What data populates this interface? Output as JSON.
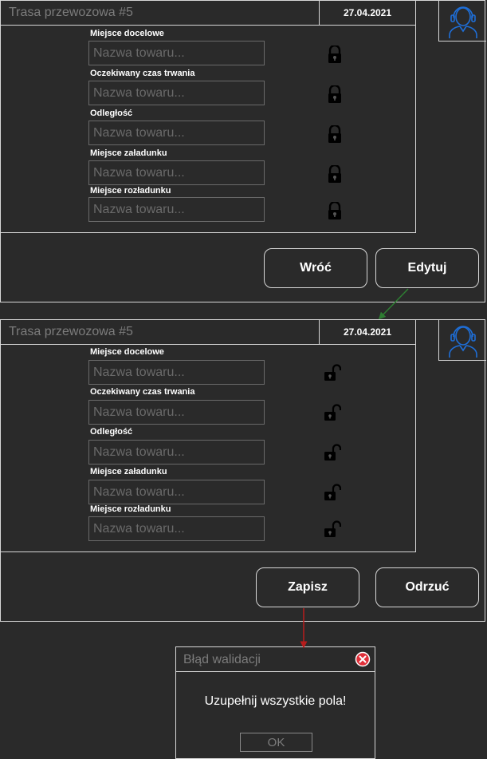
{
  "screen_view": {
    "title": "Trasa przewozowa #5",
    "date": "27.04.2021",
    "fields": [
      {
        "label": "Miejsce docelowe",
        "placeholder": "Nazwa towaru..."
      },
      {
        "label": "Oczekiwany czas trwania",
        "placeholder": "Nazwa towaru..."
      },
      {
        "label": "Odległość",
        "placeholder": "Nazwa towaru..."
      },
      {
        "label": "Miejsce załadunku",
        "placeholder": "Nazwa towaru..."
      },
      {
        "label": "Miejsce rozładunku",
        "placeholder": "Nazwa towaru..."
      }
    ],
    "field_state": "locked",
    "back_label": "Wróć",
    "edit_label": "Edytuj"
  },
  "screen_edit": {
    "title": "Trasa przewozowa #5",
    "date": "27.04.2021",
    "fields": [
      {
        "label": "Miejsce docelowe",
        "placeholder": "Nazwa towaru..."
      },
      {
        "label": "Oczekiwany czas trwania",
        "placeholder": "Nazwa towaru..."
      },
      {
        "label": "Odległość",
        "placeholder": "Nazwa towaru..."
      },
      {
        "label": "Miejsce załadunku",
        "placeholder": "Nazwa towaru..."
      },
      {
        "label": "Miejsce rozładunku",
        "placeholder": "Nazwa towaru..."
      }
    ],
    "field_state": "unlocked",
    "save_label": "Zapisz",
    "discard_label": "Odrzuć"
  },
  "dialog": {
    "title": "Błąd walidacji",
    "message": "Uzupełnij wszystkie pola!",
    "ok_label": "OK"
  },
  "colors": {
    "background": "#2a2a2a",
    "border": "#d7d7d7",
    "muted_text": "#7c7c7c",
    "avatar_blue": "#1e6fd9",
    "arrow_green": "#2e7d32",
    "arrow_red": "#b71c1c",
    "close_red": "#e0303a"
  },
  "icons": {
    "avatar": "user-headset-icon",
    "locked": "lock-closed-icon",
    "unlocked": "lock-open-icon",
    "close": "close-circle-icon"
  }
}
